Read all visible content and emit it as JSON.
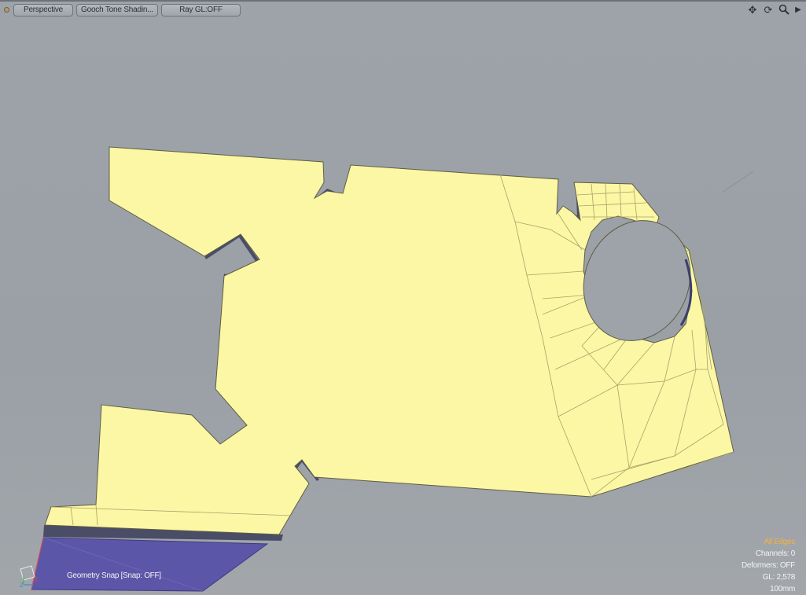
{
  "viewport": {
    "view_mode": "Perspective",
    "shading": "Gooch Tone Shadin...",
    "raygl": "Ray GL:OFF"
  },
  "nav_icons": [
    "move-view-icon",
    "rotate-view-icon",
    "zoom-view-icon",
    "expand-arrow-icon"
  ],
  "status": {
    "selection_mode": "All Edges",
    "channels": "Channels: 0",
    "deformers": "Deformers: OFF",
    "gl": "GL: 2,578",
    "scale": "100mm"
  },
  "snap": "Geometry Snap [Snap: OFF]",
  "colors": {
    "background": "#9ea3aa",
    "mesh_fill": "#fbf7a4",
    "mesh_edge": "#8c8a5c",
    "selected_face": "#5c56a8",
    "highlight_text": "#f3b13e"
  }
}
